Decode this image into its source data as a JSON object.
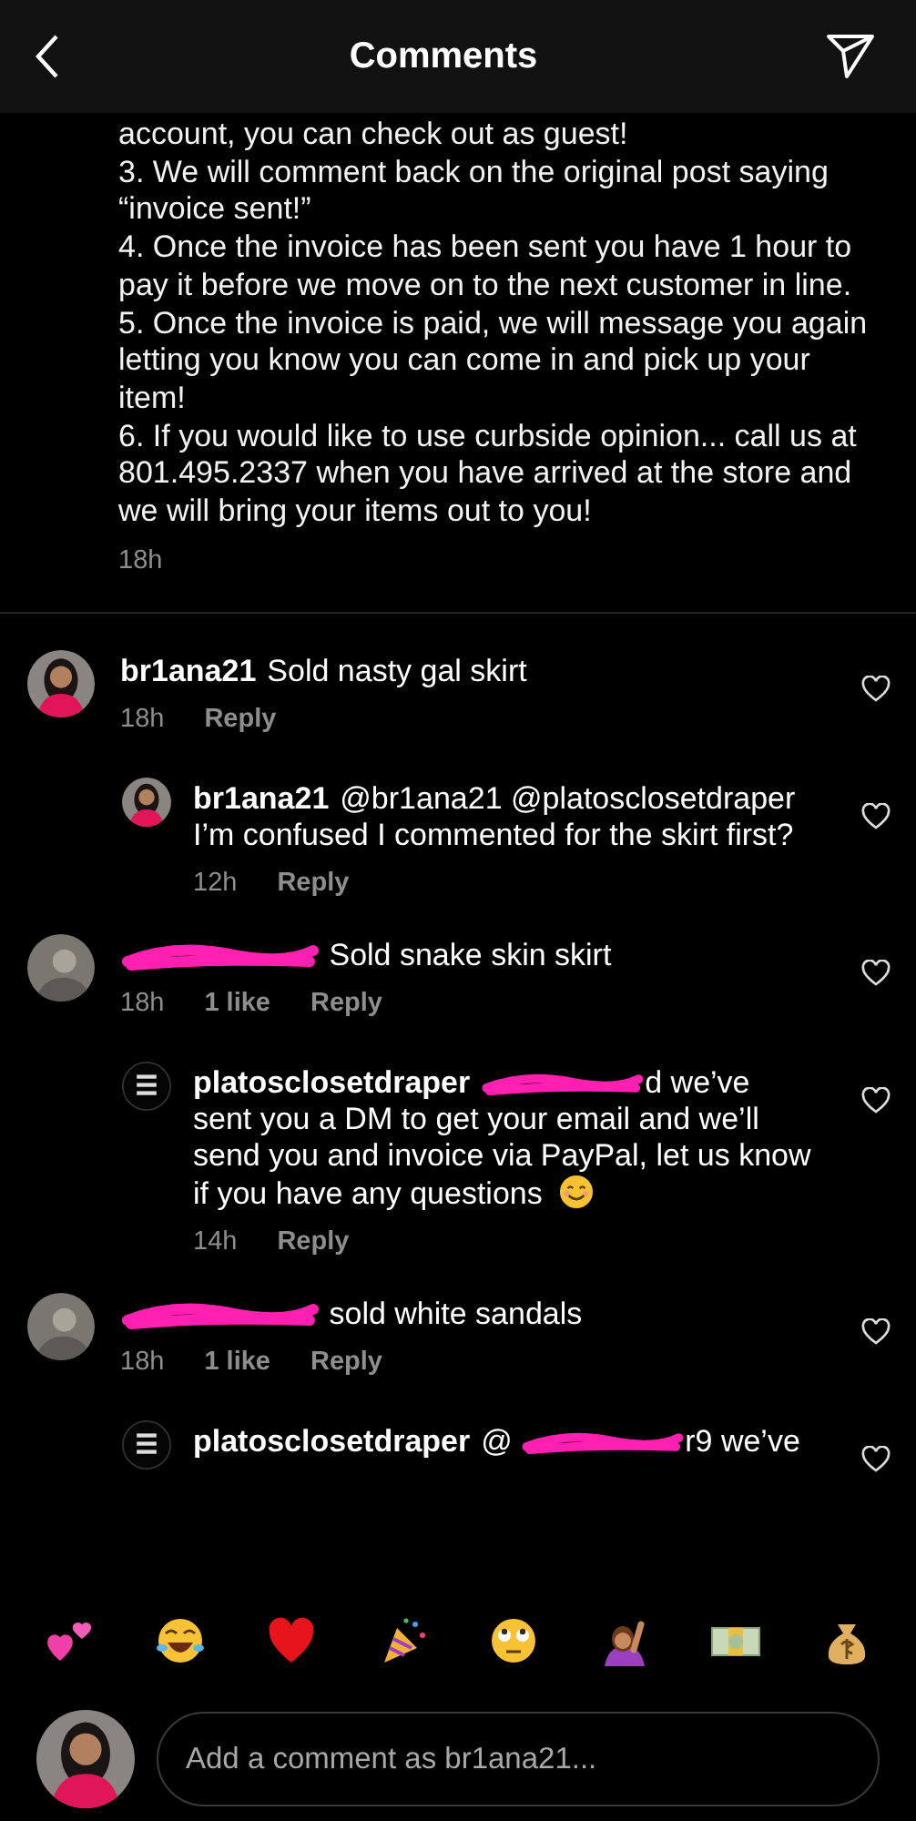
{
  "header": {
    "title": "Comments"
  },
  "caption": {
    "paragraphs": [
      "account, you can check out as guest!",
      "3. We will comment back on the original post saying “invoice sent!”",
      "4. Once the invoice has been sent you have 1 hour to pay it before we move on to the next customer in line.",
      "5. Once the invoice is paid, we will message you again letting you know you can come in and pick up your item!",
      "6. If you would like to use curbside opinion... call us at 801.495.2337 when you have arrived at the store and we will bring your items out to you!"
    ],
    "time": "18h"
  },
  "comments": [
    {
      "avatar": {
        "kind": "photo"
      },
      "username": "br1ana21",
      "username_redacted": false,
      "segments": [
        {
          "kind": "text",
          "text": "Sold nasty gal skirt"
        }
      ],
      "time": "18h",
      "reply_label": "Reply",
      "replies": [
        {
          "avatar": {
            "kind": "photo"
          },
          "username": "br1ana21",
          "username_redacted": false,
          "segments": [
            {
              "kind": "text",
              "text": "@br1ana21 @platosclosetdraper I’m confused I commented for the skirt first?"
            }
          ],
          "time": "12h",
          "reply_label": "Reply"
        }
      ]
    },
    {
      "avatar": {
        "kind": "blurred"
      },
      "username_redacted": true,
      "segments": [
        {
          "kind": "text",
          "text": "Sold snake skin skirt"
        }
      ],
      "time": "18h",
      "likes": "1 like",
      "reply_label": "Reply",
      "replies": [
        {
          "avatar": {
            "kind": "logo"
          },
          "username": "platosclosetdraper",
          "username_redacted": false,
          "segments": [
            {
              "kind": "redaction"
            },
            {
              "kind": "text",
              "text": "d we’ve sent you a DM to get your email and we’ll send you and invoice via PayPal, let us know if you have any questions"
            },
            {
              "kind": "emoji"
            }
          ],
          "time": "14h",
          "reply_label": "Reply"
        }
      ]
    },
    {
      "avatar": {
        "kind": "blurred"
      },
      "username_redacted": true,
      "segments": [
        {
          "kind": "text",
          "text": "sold white sandals"
        }
      ],
      "time": "18h",
      "likes": "1 like",
      "reply_label": "Reply",
      "replies": [
        {
          "avatar": {
            "kind": "logo"
          },
          "username": "platosclosetdraper",
          "username_redacted": false,
          "segments": [
            {
              "kind": "text",
              "text": "@"
            },
            {
              "kind": "redaction"
            },
            {
              "kind": "text",
              "text": "r9 we’ve"
            }
          ]
        }
      ]
    }
  ],
  "emoji_bar": [
    {
      "kind": "hearts"
    },
    {
      "kind": "joy"
    },
    {
      "kind": "heart"
    },
    {
      "kind": "party"
    },
    {
      "kind": "eyeroll"
    },
    {
      "kind": "raise_hand"
    },
    {
      "kind": "dollar"
    },
    {
      "kind": "moneybag"
    }
  ],
  "composer": {
    "placeholder": "Add a comment as br1ana21..."
  }
}
